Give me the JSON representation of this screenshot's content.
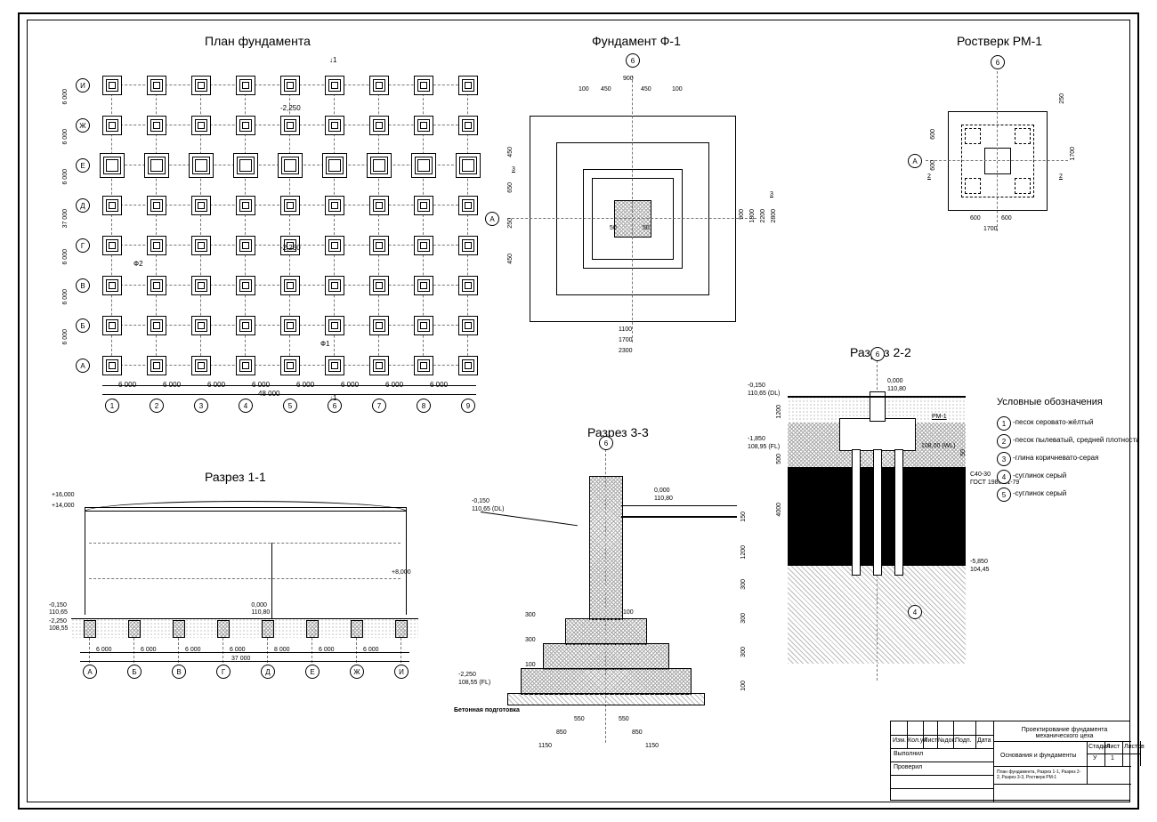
{
  "titles": {
    "plan": "План фундамента",
    "f1": "Фундамент Ф-1",
    "rm1": "Ростверк РМ-1",
    "s11": "Разрез 1-1",
    "s22": "Разрез 2-2",
    "s33": "Разрез 3-3",
    "legend": "Условные обозначения"
  },
  "plan": {
    "rows": [
      "И",
      "Ж",
      "Е",
      "Д",
      "Г",
      "В",
      "Б",
      "А"
    ],
    "cols": [
      "1",
      "2",
      "3",
      "4",
      "5",
      "6",
      "7",
      "8",
      "9"
    ],
    "rowDims": [
      "6 000",
      "6 000",
      "6 000",
      "37 000",
      "6 000",
      "6 000",
      "6 000"
    ],
    "colDim": "6 000",
    "total": "48 000",
    "rowTotal": "37 000",
    "notes": [
      "-2,250",
      "-2,250"
    ],
    "labels": [
      "Ф1",
      "Ф2"
    ],
    "cut": "1"
  },
  "f1": {
    "axis": "6",
    "row": "А",
    "topDims": [
      "100",
      "450",
      "450",
      "100"
    ],
    "top900": "900",
    "leftDims": [
      "450",
      "650",
      "250",
      "450"
    ],
    "rightDims": [
      "900",
      "1800",
      "2200",
      "2800"
    ],
    "bottomDims": [
      "1100",
      "1700",
      "2300"
    ],
    "inner": [
      "50",
      "50"
    ],
    "sec3": "3"
  },
  "rm1": {
    "axis": "6",
    "row": "А",
    "top": "250",
    "left": [
      "600",
      "600"
    ],
    "right": "1700",
    "bottom": [
      "600",
      "600",
      "1700"
    ],
    "sec2": "2"
  },
  "s11": {
    "axes": [
      "А",
      "Б",
      "В",
      "Г",
      "Д",
      "Е",
      "Ж",
      "И"
    ],
    "dims": [
      "6 000",
      "6 000",
      "6 000",
      "6 000",
      "8 000",
      "6 000",
      "6 000"
    ],
    "total": "37 000",
    "levels": [
      "+16,000",
      "+14,000",
      "+8,000",
      "0,000",
      "110,80",
      "-0,150",
      "110,65",
      "-2,250",
      "108,55"
    ]
  },
  "s33": {
    "axis": "6",
    "levels": [
      "0,000",
      "110,80",
      "-0,150",
      "110,65 (DL)",
      "-2,250",
      "108,55 (FL)"
    ],
    "rdims": [
      "150",
      "1200",
      "300",
      "300",
      "300",
      "100"
    ],
    "bdims": [
      "550",
      "550",
      "850",
      "850",
      "1150",
      "1150"
    ],
    "ldims": [
      "300",
      "300",
      "100"
    ],
    "note": "Бетонная подготовка"
  },
  "s22": {
    "axis": "6",
    "levels": [
      "0,000",
      "110,80",
      "-0,150",
      "110,65 (DL)",
      "-1,850",
      "108,95 (FL)",
      "108,00 (WL)",
      "-5,850",
      "104,45"
    ],
    "ldims": [
      "1200",
      "500",
      "4000"
    ],
    "rdims": [
      "50"
    ],
    "pile": "С40-30",
    "gost": "ГОСТ 19804.1-79",
    "rm": "РМ-1"
  },
  "legend": [
    "-песок серовато-жёлтый",
    "-песок пылеватый, средней плотности",
    "-глина коричневато-серая",
    "-суглинок серый",
    "-суглинок серый"
  ],
  "legendNums": [
    "1",
    "2",
    "3",
    "4",
    "5"
  ],
  "titleblock": {
    "r1": [
      "Изм.",
      "Кол.уч",
      "Лист",
      "№док.",
      "Подп.",
      "Дата"
    ],
    "r2": "Выполнил",
    "r3": "Проверил",
    "proj": "Проектирование фундамента механического цеха",
    "sub": "Основания и фундаменты",
    "sheet": "План фундамента, Разрез 1-1, Разрез 2-2, Разрез 3-3, Ростверк РМ-1",
    "cols": [
      "Стадия",
      "Лист",
      "Листов"
    ],
    "vals": [
      "У",
      "1",
      ""
    ]
  }
}
